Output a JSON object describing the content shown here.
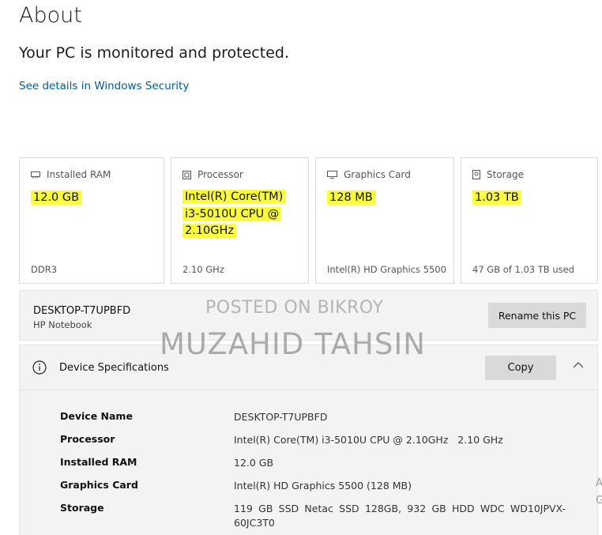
{
  "page": {
    "title": "About",
    "status": "Your PC is monitored and protected.",
    "security_link": "See details in Windows Security"
  },
  "cards": [
    {
      "label": "Installed RAM",
      "icon": "ram-icon",
      "value": "12.0 GB",
      "sub": "DDR3"
    },
    {
      "label": "Processor",
      "icon": "processor-icon",
      "value_lines": [
        "Intel(R) Core(TM)",
        "i3-5010U CPU @",
        "2.10GHz"
      ],
      "sub": "2.10 GHz"
    },
    {
      "label": "Graphics Card",
      "icon": "graphics-card-icon",
      "value": "128 MB",
      "sub": "Intel(R) HD Graphics 5500"
    },
    {
      "label": "Storage",
      "icon": "storage-icon",
      "value": "1.03 TB",
      "sub": "47 GB of 1.03 TB used"
    }
  ],
  "pc": {
    "name": "DESKTOP-T7UPBFD",
    "model": "HP Notebook",
    "rename_label": "Rename this PC"
  },
  "specs": {
    "title": "Device Specifications",
    "copy_label": "Copy",
    "rows": [
      {
        "key": "Device Name",
        "value": "DESKTOP-T7UPBFD"
      },
      {
        "key": "Processor",
        "value": "Intel(R) Core(TM) i3-5010U CPU @ 2.10GHz   2.10 GHz"
      },
      {
        "key": "Installed RAM",
        "value": "12.0 GB"
      },
      {
        "key": "Graphics Card",
        "value": "Intel(R) HD Graphics 5500 (128 MB)"
      },
      {
        "key": "Storage",
        "value": "119 GB SSD Netac SSD 128GB, 932 GB HDD WDC WD10JPVX-60JC3T0"
      }
    ]
  },
  "watermark": {
    "line1": "POSTED ON BIKROY",
    "line2": "MUZAHID TAHSIN"
  },
  "edge_glyphs": [
    "A",
    "G"
  ],
  "colors": {
    "highlight": "#fbff3d",
    "link": "#005a9e",
    "panel": "#f3f3f3",
    "button": "#d9d9d9"
  }
}
